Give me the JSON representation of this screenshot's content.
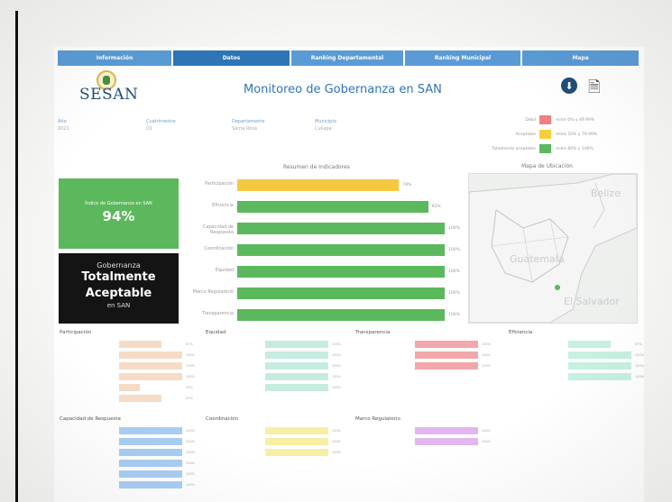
{
  "nav": {
    "tabs": [
      {
        "label": "Información"
      },
      {
        "label": "Datos"
      },
      {
        "label": "Ranking Departamental"
      },
      {
        "label": "Ranking Municipal"
      },
      {
        "label": "Mapa"
      }
    ]
  },
  "header": {
    "logo_text": "SESAN",
    "logo_subtext": "",
    "title": "Monitoreo de Gobernanza en SAN",
    "download_icon": "download-icon",
    "pdf_icon": "pdf-export-icon"
  },
  "filters": [
    {
      "label": "Año",
      "value": "2021"
    },
    {
      "label": "Cuatrimestre",
      "value": "Q1"
    },
    {
      "label": "Departamento",
      "value": "Santa Rosa"
    },
    {
      "label": "Municipio",
      "value": "Cuilapa"
    }
  ],
  "legend": [
    {
      "label": "Débil",
      "range": "entre 0% y 49.99%",
      "color": "#f08080"
    },
    {
      "label": "Aceptable",
      "range": "entre 50% y 79.99%",
      "color": "#f5cf3a"
    },
    {
      "label": "Totalmente aceptable",
      "range": "entre 80% y 100%",
      "color": "#5cb85c"
    }
  ],
  "summary": {
    "title": "Resumen de Indicadores",
    "index_label": "Índice de Gobernanza en SAN",
    "index_value": "94%",
    "status_line1": "Gobernanza",
    "status_line2": "Totalmente",
    "status_line3": "Aceptable",
    "status_line4": "en SAN"
  },
  "indicators": [
    {
      "label": "Participación",
      "percent": 78,
      "display": "78%",
      "color": "#f5c842"
    },
    {
      "label": "Eficiencia",
      "percent": 92,
      "display": "92%",
      "color": "#5cb85c"
    },
    {
      "label": "Capacidad de Respuesta",
      "percent": 100,
      "display": "100%",
      "color": "#5cb85c"
    },
    {
      "label": "Coordinación",
      "percent": 100,
      "display": "100%",
      "color": "#5cb85c"
    },
    {
      "label": "Equidad",
      "percent": 100,
      "display": "100%",
      "color": "#5cb85c"
    },
    {
      "label": "Marco Regulatorio",
      "percent": 100,
      "display": "100%",
      "color": "#5cb85c"
    },
    {
      "label": "Transparencia",
      "percent": 100,
      "display": "100%",
      "color": "#5cb85c"
    }
  ],
  "map": {
    "title": "Mapa de Ubicación",
    "labels": [
      "Belize",
      "Guatemala",
      "El Salvador"
    ]
  },
  "panels": [
    {
      "title": "Participación",
      "color": "#f6dcc6",
      "rows": [
        {
          "label": "",
          "percent": 67,
          "display": "67%"
        },
        {
          "label": "",
          "percent": 100,
          "display": "100%"
        },
        {
          "label": "",
          "percent": 100,
          "display": "100%"
        },
        {
          "label": "",
          "percent": 100,
          "display": "100%"
        },
        {
          "label": "",
          "percent": 33,
          "display": "33%"
        },
        {
          "label": "",
          "percent": 67,
          "display": "67%"
        }
      ]
    },
    {
      "title": "Equidad",
      "color": "#c6ebe0",
      "rows": [
        {
          "label": "",
          "percent": 100,
          "display": "100%"
        },
        {
          "label": "",
          "percent": 100,
          "display": "100%"
        },
        {
          "label": "",
          "percent": 100,
          "display": "100%"
        },
        {
          "label": "",
          "percent": 100,
          "display": "100%"
        },
        {
          "label": "",
          "percent": 100,
          "display": "100%"
        }
      ]
    },
    {
      "title": "Transparencia",
      "color": "#f2a7aa",
      "rows": [
        {
          "label": "",
          "percent": 100,
          "display": "100%"
        },
        {
          "label": "",
          "percent": 100,
          "display": "100%"
        },
        {
          "label": "",
          "percent": 100,
          "display": "100%"
        }
      ]
    },
    {
      "title": "Eficiencia",
      "color": "#c6f0e0",
      "rows": [
        {
          "label": "",
          "percent": 67,
          "display": "67%"
        },
        {
          "label": "",
          "percent": 100,
          "display": "100%"
        },
        {
          "label": "",
          "percent": 100,
          "display": "100%"
        },
        {
          "label": "",
          "percent": 100,
          "display": "100%"
        }
      ]
    },
    {
      "title": "Capacidad de Respuesta",
      "color": "#a9cdf2",
      "rows": [
        {
          "label": "",
          "percent": 100,
          "display": "100%"
        },
        {
          "label": "",
          "percent": 100,
          "display": "100%"
        },
        {
          "label": "",
          "percent": 100,
          "display": "100%"
        },
        {
          "label": "",
          "percent": 100,
          "display": "100%"
        },
        {
          "label": "",
          "percent": 100,
          "display": "100%"
        },
        {
          "label": "",
          "percent": 100,
          "display": "100%"
        }
      ]
    },
    {
      "title": "Coordinación",
      "color": "#f7efa6",
      "rows": [
        {
          "label": "",
          "percent": 100,
          "display": "100%"
        },
        {
          "label": "",
          "percent": 100,
          "display": "100%"
        },
        {
          "label": "",
          "percent": 100,
          "display": "100%"
        }
      ]
    },
    {
      "title": "Marco Regulatorio",
      "color": "#e2b6ee",
      "rows": [
        {
          "label": "",
          "percent": 100,
          "display": "100%"
        },
        {
          "label": "",
          "percent": 100,
          "display": "100%"
        }
      ]
    }
  ]
}
